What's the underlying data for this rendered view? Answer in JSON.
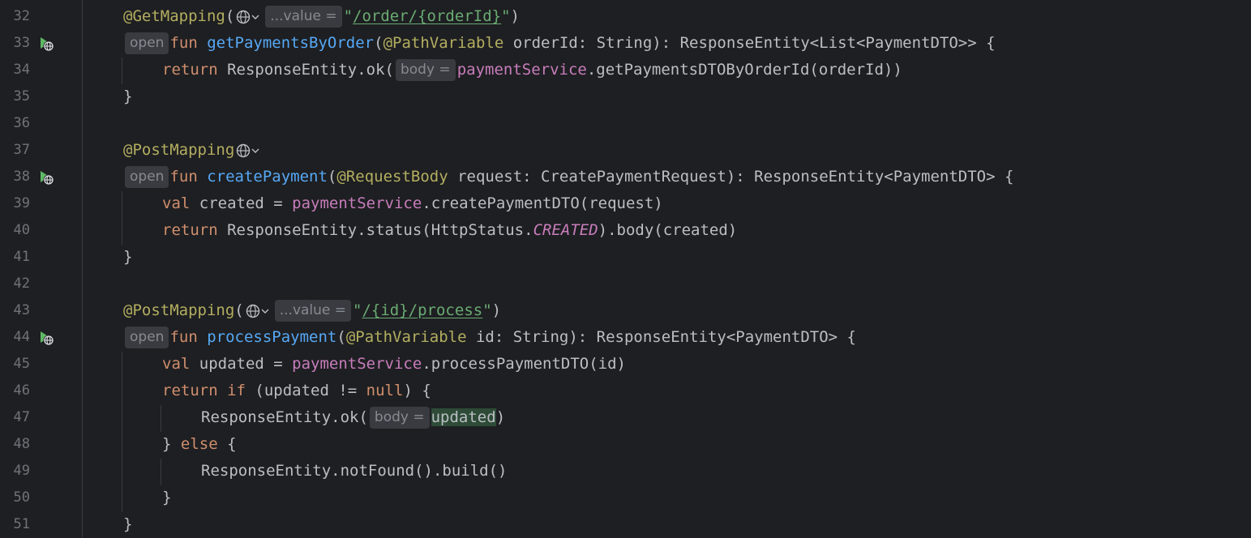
{
  "lines": [
    {
      "num": "32",
      "icon": false,
      "segs": [
        {
          "k": "ann",
          "t": "@GetMapping"
        },
        {
          "k": "p",
          "t": "("
        },
        {
          "k": "globe",
          "t": "web-request-icon"
        },
        {
          "k": "hint",
          "t": "...value ="
        },
        {
          "k": "str",
          "t": "\""
        },
        {
          "k": "strU",
          "t": "/order/{orderId}"
        },
        {
          "k": "str",
          "t": "\""
        },
        {
          "k": "p",
          "t": ")"
        }
      ]
    },
    {
      "num": "33",
      "icon": true,
      "segs": [
        {
          "k": "hintopen",
          "t": "open"
        },
        {
          "k": "kw",
          "t": "fun "
        },
        {
          "k": "fn",
          "t": "getPaymentsByOrder"
        },
        {
          "k": "p",
          "t": "("
        },
        {
          "k": "ann",
          "t": "@PathVariable"
        },
        {
          "k": "p",
          "t": " orderId: String): ResponseEntity<List<PaymentDTO>> {"
        }
      ]
    },
    {
      "num": "34",
      "icon": false,
      "segs": [
        {
          "k": "kw",
          "t": "return "
        },
        {
          "k": "p",
          "t": "ResponseEntity.ok("
        },
        {
          "k": "hint",
          "t": "body ="
        },
        {
          "k": "prop",
          "t": "paymentService"
        },
        {
          "k": "p",
          "t": ".getPaymentsDTOByOrderId(orderId))"
        }
      ]
    },
    {
      "num": "35",
      "icon": false,
      "segs": [
        {
          "k": "p",
          "t": "}"
        }
      ]
    },
    {
      "num": "36",
      "icon": false,
      "segs": []
    },
    {
      "num": "37",
      "icon": false,
      "segs": [
        {
          "k": "ann",
          "t": "@PostMapping"
        },
        {
          "k": "globe",
          "t": "web-request-icon"
        }
      ]
    },
    {
      "num": "38",
      "icon": true,
      "segs": [
        {
          "k": "hintopen",
          "t": "open"
        },
        {
          "k": "kw",
          "t": "fun "
        },
        {
          "k": "fn",
          "t": "createPayment"
        },
        {
          "k": "p",
          "t": "("
        },
        {
          "k": "ann",
          "t": "@RequestBody"
        },
        {
          "k": "p",
          "t": " request: CreatePaymentRequest): ResponseEntity<PaymentDTO> {"
        }
      ]
    },
    {
      "num": "39",
      "icon": false,
      "segs": [
        {
          "k": "kw",
          "t": "val "
        },
        {
          "k": "p",
          "t": "created = "
        },
        {
          "k": "prop",
          "t": "paymentService"
        },
        {
          "k": "p",
          "t": ".createPaymentDTO(request)"
        }
      ]
    },
    {
      "num": "40",
      "icon": false,
      "segs": [
        {
          "k": "kw",
          "t": "return "
        },
        {
          "k": "p",
          "t": "ResponseEntity.status(HttpStatus."
        },
        {
          "k": "const",
          "t": "CREATED"
        },
        {
          "k": "p",
          "t": ").body(created)"
        }
      ]
    },
    {
      "num": "41",
      "icon": false,
      "segs": [
        {
          "k": "p",
          "t": "}"
        }
      ]
    },
    {
      "num": "42",
      "icon": false,
      "segs": []
    },
    {
      "num": "43",
      "icon": false,
      "segs": [
        {
          "k": "ann",
          "t": "@PostMapping"
        },
        {
          "k": "p",
          "t": "("
        },
        {
          "k": "globe",
          "t": "web-request-icon"
        },
        {
          "k": "hint",
          "t": "...value ="
        },
        {
          "k": "str",
          "t": "\""
        },
        {
          "k": "strU",
          "t": "/{id}/process"
        },
        {
          "k": "str",
          "t": "\""
        },
        {
          "k": "p",
          "t": ")"
        }
      ]
    },
    {
      "num": "44",
      "icon": true,
      "segs": [
        {
          "k": "hintopen",
          "t": "open"
        },
        {
          "k": "kw",
          "t": "fun "
        },
        {
          "k": "fn",
          "t": "processPayment"
        },
        {
          "k": "p",
          "t": "("
        },
        {
          "k": "ann",
          "t": "@PathVariable"
        },
        {
          "k": "p",
          "t": " id: String): ResponseEntity<PaymentDTO> {"
        }
      ]
    },
    {
      "num": "45",
      "icon": false,
      "segs": [
        {
          "k": "kw",
          "t": "val "
        },
        {
          "k": "p",
          "t": "updated = "
        },
        {
          "k": "prop",
          "t": "paymentService"
        },
        {
          "k": "p",
          "t": ".processPaymentDTO(id)"
        }
      ]
    },
    {
      "num": "46",
      "icon": false,
      "segs": [
        {
          "k": "kw",
          "t": "return if "
        },
        {
          "k": "p",
          "t": "(updated != "
        },
        {
          "k": "kw",
          "t": "null"
        },
        {
          "k": "p",
          "t": ") {"
        }
      ]
    },
    {
      "num": "47",
      "icon": false,
      "segs": [
        {
          "k": "p",
          "t": "ResponseEntity.ok("
        },
        {
          "k": "hint",
          "t": "body ="
        },
        {
          "k": "hl",
          "t": "updated"
        },
        {
          "k": "p",
          "t": ")"
        }
      ]
    },
    {
      "num": "48",
      "icon": false,
      "segs": [
        {
          "k": "p",
          "t": "} "
        },
        {
          "k": "kw",
          "t": "else "
        },
        {
          "k": "p",
          "t": "{"
        }
      ]
    },
    {
      "num": "49",
      "icon": false,
      "segs": [
        {
          "k": "p",
          "t": "ResponseEntity.notFound().build()"
        }
      ]
    },
    {
      "num": "50",
      "icon": false,
      "segs": [
        {
          "k": "p",
          "t": "}"
        }
      ]
    },
    {
      "num": "51",
      "icon": false,
      "segs": [
        {
          "k": "p",
          "t": "}"
        }
      ]
    }
  ],
  "gutter_icon": "run-endpoint-icon",
  "colors": {
    "background": "#1e1f22",
    "keyword": "#cf8e6d",
    "function": "#56a8f5",
    "annotation": "#b3ae60",
    "string": "#6aab73",
    "property": "#c77dbb",
    "hint_bg": "#393b40",
    "run_icon": "#5fb865"
  }
}
